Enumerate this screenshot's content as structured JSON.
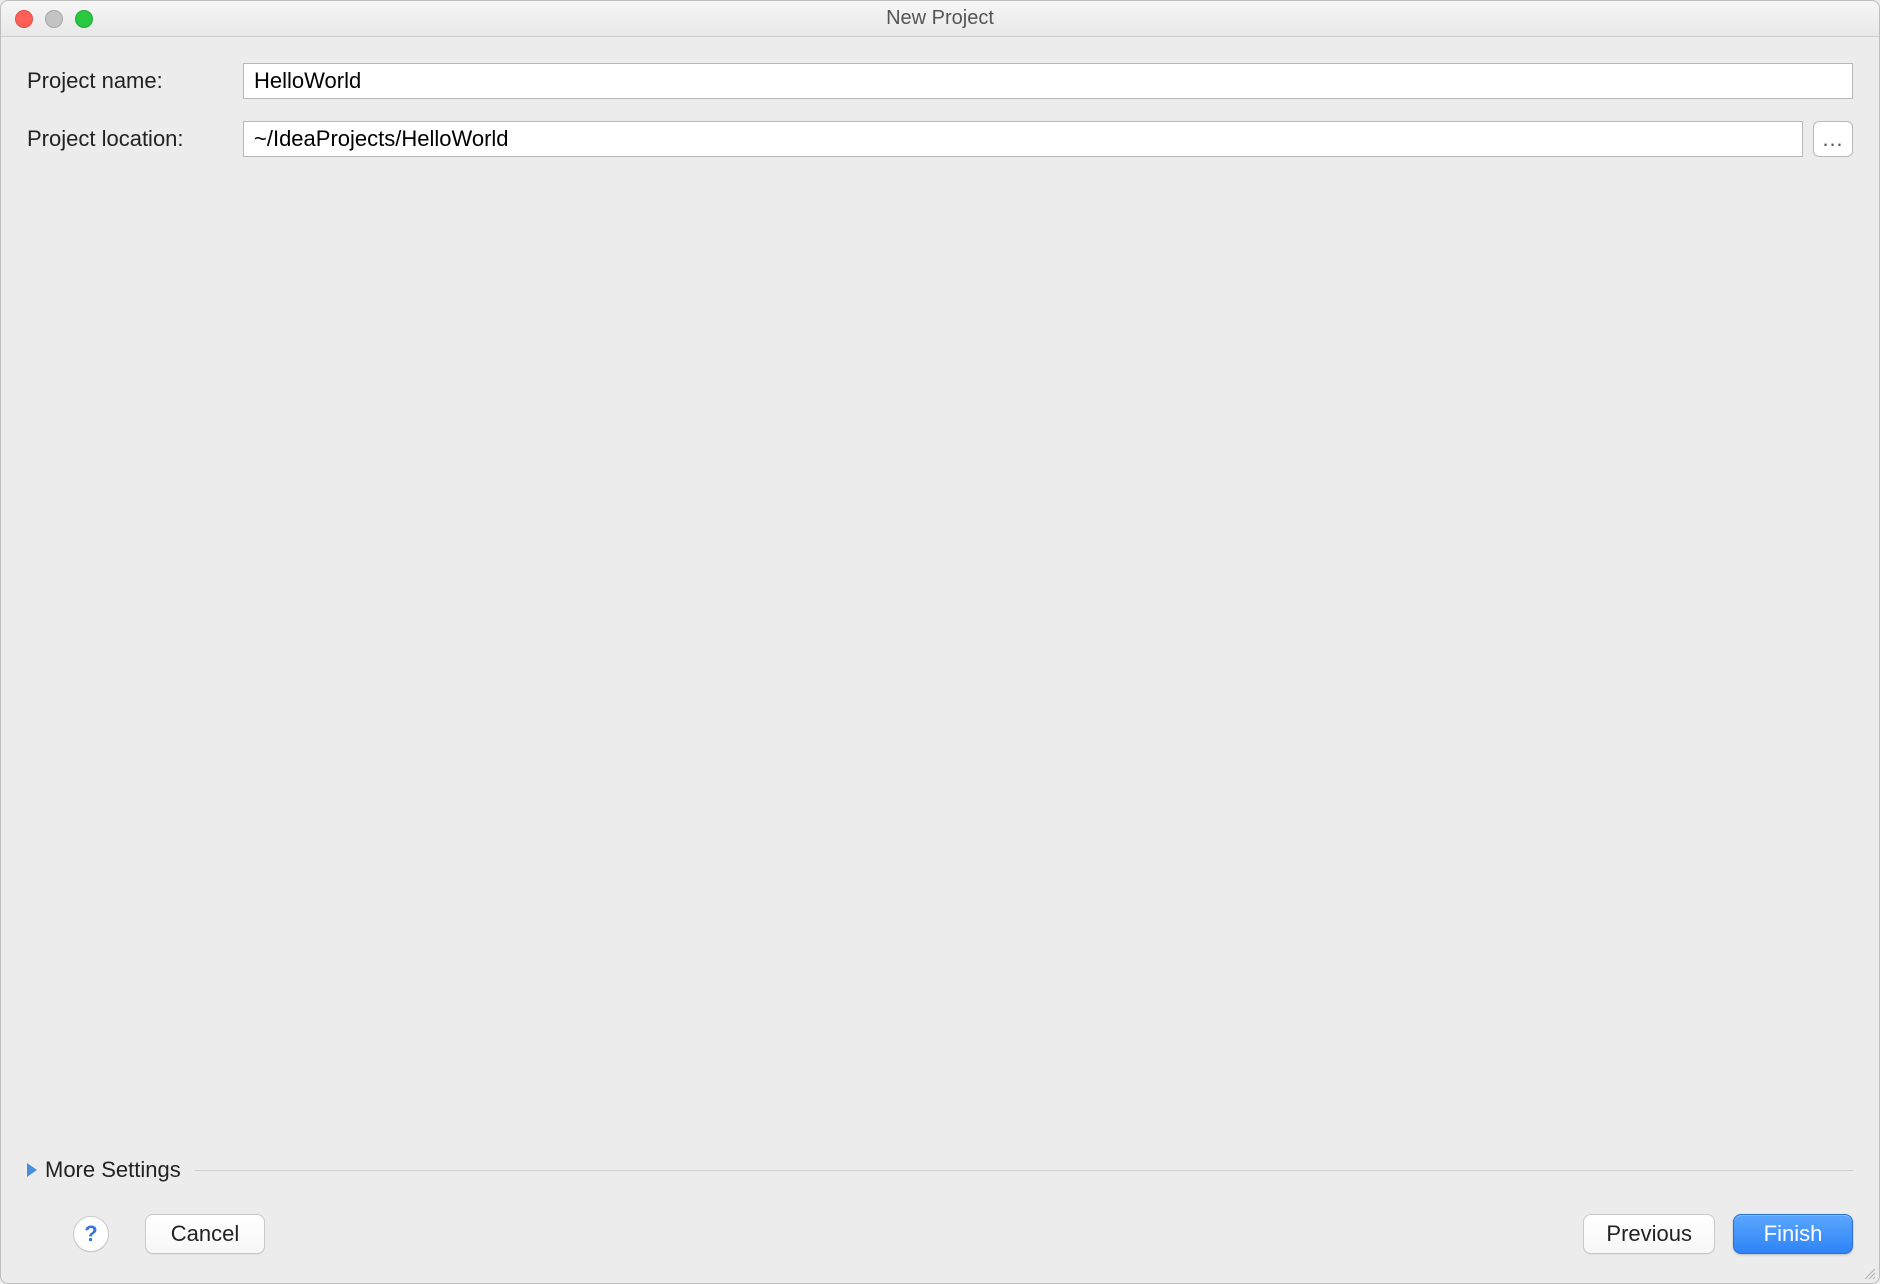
{
  "window": {
    "title": "New Project"
  },
  "form": {
    "project_name_label": "Project name:",
    "project_name_value": "HelloWorld",
    "project_location_label": "Project location:",
    "project_location_value": "~/IdeaProjects/HelloWorld",
    "browse_label": "…"
  },
  "more_settings": {
    "label": "More Settings",
    "expanded": false
  },
  "buttons": {
    "help_label": "?",
    "cancel_label": "Cancel",
    "previous_label": "Previous",
    "finish_label": "Finish"
  }
}
